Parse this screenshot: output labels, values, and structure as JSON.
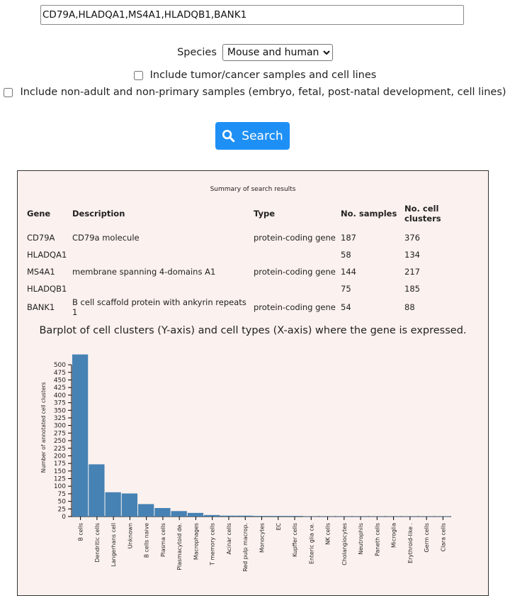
{
  "search": {
    "genes_value": "CD79A,HLADQA1,MS4A1,HLADQB1,BANK1"
  },
  "species": {
    "label": "Species",
    "selected": "Mouse and human"
  },
  "options": {
    "include_tumor_label": "Include tumor/cancer samples and cell lines",
    "include_non_adult_label": "Include non-adult and non-primary samples (embryo, fetal, post-natal development, cell lines)",
    "include_tumor_checked": false,
    "include_non_adult_checked": false
  },
  "search_button": {
    "label": "Search",
    "icon": "search-icon",
    "color": "#1e90f5"
  },
  "results": {
    "summary_title": "Summary of search results",
    "columns": [
      "Gene",
      "Description",
      "Type",
      "No. samples",
      "No. cell clusters"
    ],
    "rows": [
      {
        "gene": "CD79A",
        "description": "CD79a molecule",
        "type": "protein-coding gene",
        "samples": "187",
        "clusters": "376"
      },
      {
        "gene": "HLADQA1",
        "description": "",
        "type": "",
        "samples": "58",
        "clusters": "134"
      },
      {
        "gene": "MS4A1",
        "description": "membrane spanning 4-domains A1",
        "type": "protein-coding gene",
        "samples": "144",
        "clusters": "217"
      },
      {
        "gene": "HLADQB1",
        "description": "",
        "type": "",
        "samples": "75",
        "clusters": "185"
      },
      {
        "gene": "BANK1",
        "description": "B cell scaffold protein with ankyrin repeats 1",
        "type": "protein-coding gene",
        "samples": "54",
        "clusters": "88"
      }
    ]
  },
  "chart_data": {
    "type": "bar",
    "title": "Barplot of cell clusters (Y-axis) and cell types (X-axis) where the gene is expressed.",
    "xlabel": "",
    "ylabel": "Number of annotated cell clusters",
    "ylim": [
      0,
      540
    ],
    "yticks": [
      0,
      25,
      50,
      75,
      100,
      125,
      150,
      175,
      200,
      225,
      250,
      275,
      300,
      325,
      350,
      375,
      400,
      425,
      450,
      475,
      500
    ],
    "grid": false,
    "bar_color": "#4682b4",
    "categories": [
      "B cells",
      "Dendritic cells",
      "Langerhans cell",
      "Unknown",
      "B cells naive",
      "Plasma cells",
      "Plasmacytoid de.",
      "Macrophages",
      "T memory cells",
      "Acinar cells",
      "Red pulp macrop.",
      "Monocytes",
      "EC",
      "Kupffer cells",
      "Enteric glia ce.",
      "NK cells",
      "Cholangiocytes",
      "Neutrophils",
      "Paneth cells",
      "Microglia",
      "Erythroid-like .",
      "Germ cells",
      "Clara cells"
    ],
    "values": [
      534,
      172,
      80,
      76,
      41,
      28,
      18,
      12,
      5,
      3,
      3,
      2,
      2,
      2,
      1,
      1,
      1,
      1,
      1,
      1,
      1,
      1,
      1
    ]
  }
}
